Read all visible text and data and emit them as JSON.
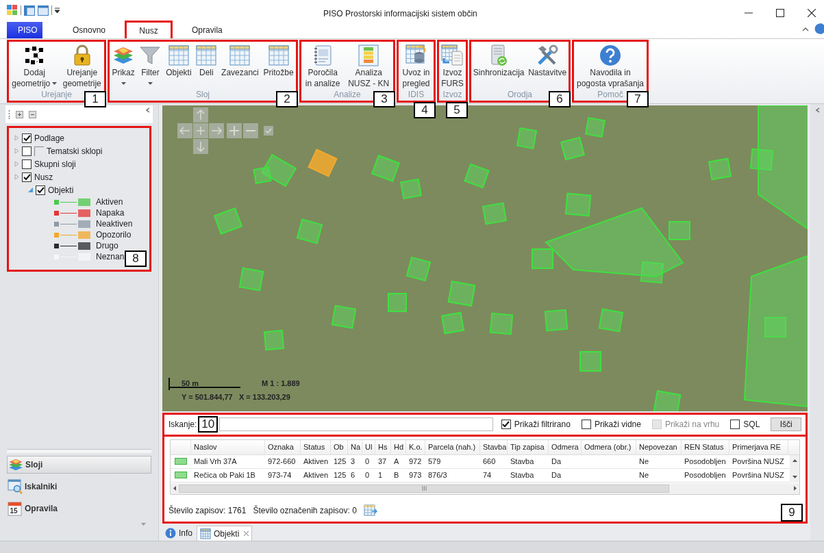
{
  "window": {
    "title": "PISO Prostorski informacijski sistem občin"
  },
  "ribbon_tabs": [
    {
      "label": "PISO",
      "kind": "app",
      "selected": false,
      "highlighted": false
    },
    {
      "label": "Osnovno",
      "kind": "tab",
      "selected": false,
      "highlighted": false
    },
    {
      "label": "Nusz",
      "kind": "tab",
      "selected": true,
      "highlighted": true
    },
    {
      "label": "Opravila",
      "kind": "tab",
      "selected": false,
      "highlighted": false
    }
  ],
  "ribbon_groups": [
    {
      "label": "Urejanje",
      "callout": "1",
      "buttons": [
        {
          "lines": [
            "Dodaj",
            "geometrijo"
          ],
          "dropdown": true
        },
        {
          "lines": [
            "Urejanje",
            "geometrije"
          ],
          "dropdown": false
        }
      ]
    },
    {
      "label": "Sloj",
      "callout": "2",
      "buttons": [
        {
          "lines": [
            "Prikaz"
          ],
          "dropdown": true
        },
        {
          "lines": [
            "Filter"
          ],
          "dropdown": true
        },
        {
          "lines": [
            "Objekti"
          ],
          "dropdown": false
        },
        {
          "lines": [
            "Deli"
          ],
          "dropdown": false
        },
        {
          "lines": [
            "Zavezanci"
          ],
          "dropdown": false
        },
        {
          "lines": [
            "Pritožbe"
          ],
          "dropdown": false
        }
      ]
    },
    {
      "label": "Analize",
      "callout": "3",
      "buttons": [
        {
          "lines": [
            "Poročila",
            "in analize"
          ],
          "dropdown": false
        },
        {
          "lines": [
            "Analiza",
            "NUSZ - KN"
          ],
          "dropdown": false
        }
      ]
    },
    {
      "label": "IDIS",
      "callout": "4",
      "buttons": [
        {
          "lines": [
            "Uvoz in",
            "pregled"
          ],
          "dropdown": false
        }
      ]
    },
    {
      "label": "Izvoz",
      "callout": "5",
      "buttons": [
        {
          "lines": [
            "Izvoz",
            "FURS"
          ],
          "dropdown": false
        }
      ]
    },
    {
      "label": "Orodja",
      "callout": "6",
      "buttons": [
        {
          "lines": [
            "Sinhronizacija"
          ],
          "dropdown": false
        },
        {
          "lines": [
            "Nastavitve"
          ],
          "dropdown": false
        }
      ]
    },
    {
      "label": "Pomoč",
      "callout": "7",
      "buttons": [
        {
          "lines": [
            "Navodila in",
            "pogosta vprašanja"
          ],
          "dropdown": false
        }
      ]
    }
  ],
  "layer_tree": {
    "callout": "8",
    "items": [
      {
        "label": "Podlage",
        "kind": "layer",
        "checked": true,
        "expanded": false
      },
      {
        "label": "Tematski sklopi",
        "kind": "group",
        "checked": false,
        "expanded": false
      },
      {
        "label": "Skupni sloji",
        "kind": "layer",
        "checked": false,
        "expanded": false
      },
      {
        "label": "Nusz",
        "kind": "layer",
        "checked": true,
        "expanded": false,
        "children": [
          {
            "label": "Objekti",
            "checked": true,
            "expanded": true,
            "legend": [
              {
                "label": "Aktiven",
                "color": "#4cc94c"
              },
              {
                "label": "Napaka",
                "color": "#e53535"
              },
              {
                "label": "Neaktiven",
                "color": "#8e99a6"
              },
              {
                "label": "Opozorilo",
                "color": "#f2a92e"
              },
              {
                "label": "Drugo",
                "color": "#2b2b2b"
              },
              {
                "label": "Neznan",
                "color": "#f7f7f7"
              }
            ]
          }
        ]
      }
    ]
  },
  "navigation": [
    {
      "label": "Sloji",
      "selected": true
    },
    {
      "label": "Iskalniki",
      "selected": false
    },
    {
      "label": "Opravila",
      "icon_text": "15",
      "selected": false
    }
  ],
  "map": {
    "scale_label": "50 m",
    "scale_ratio": "M 1 : 1.889",
    "coordinates": "Y = 501.844,77   X = 133.203,29"
  },
  "search": {
    "label": "Iskanje:",
    "callout": "10",
    "options": [
      {
        "label": "Prikaži filtrirano",
        "checked": true,
        "disabled": false
      },
      {
        "label": "Prikaži vidne",
        "checked": false,
        "disabled": false
      },
      {
        "label": "Prikaži na vrhu",
        "checked": false,
        "disabled": true
      },
      {
        "label": "SQL",
        "checked": false,
        "disabled": false
      }
    ],
    "button": "Išči"
  },
  "table": {
    "callout": "9",
    "columns": [
      "Naslov",
      "Oznaka",
      "Status",
      "Ob",
      "Na",
      "Ul",
      "Hs",
      "Hd",
      "K.o.",
      "Parcela (nah.)",
      "Stavba",
      "Tip zapisa",
      "Odmera",
      "Odmera (obr.)",
      "Nepovezan",
      "REN Status",
      "Primerjava RE"
    ],
    "rows": [
      {
        "color": "#8fdc8f",
        "cells": [
          "Mali Vrh 37A",
          "972-660",
          "Aktiven",
          "125",
          "3",
          "0",
          "37",
          "A",
          "972",
          "579",
          "660",
          "Stavba",
          "Da",
          null,
          "Ne",
          "Posodobljen",
          "Površina NUSZ"
        ]
      },
      {
        "color": "#8fdc8f",
        "cells": [
          "Rečica ob Paki 1B",
          "973-74",
          "Aktiven",
          "125",
          "6",
          "0",
          "1",
          "B",
          "973",
          "876/3",
          "74",
          "Stavba",
          "Da",
          null,
          "Ne",
          "Posodobljen",
          "Površina NUSZ"
        ]
      }
    ],
    "record_count": "Število zapisov: 1761",
    "selected_count": "Število označenih zapisov: 0"
  },
  "bottom_tabs": [
    {
      "label": "Info",
      "selected": false,
      "closable": false
    },
    {
      "label": "Objekti",
      "selected": true,
      "closable": true
    }
  ]
}
